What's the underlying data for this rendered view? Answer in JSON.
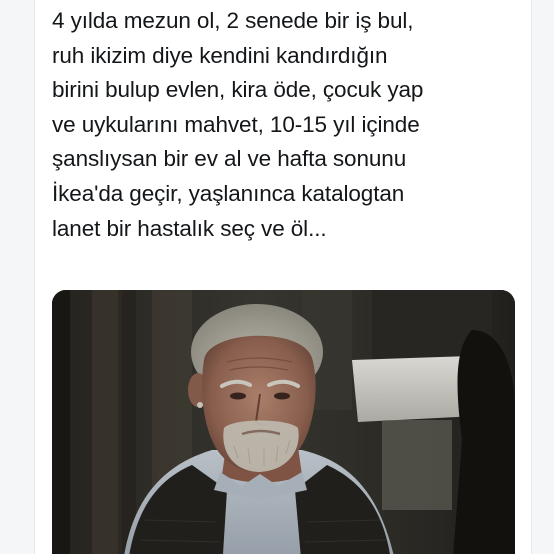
{
  "tweet": {
    "lines": [
      "4 yılda mezun ol, 2 senede bir iş bul,",
      "ruh ikizim diye kendini kandırdığın",
      "birini bulup evlen, kira öde, çocuk yap",
      "ve uykularını mahvet, 10-15 yıl içinde",
      "şanslıysan bir ev al ve hafta sonunu",
      "İkea'da geçir, yaşlanınca katalogtan",
      "lanet bir hastalık seç ve öl..."
    ]
  },
  "media": {
    "type": "photo",
    "subject": "film-still-old-man"
  },
  "colors": {
    "text": "#14171a",
    "background": "#ffffff",
    "gutter": "#f5f6f7"
  }
}
